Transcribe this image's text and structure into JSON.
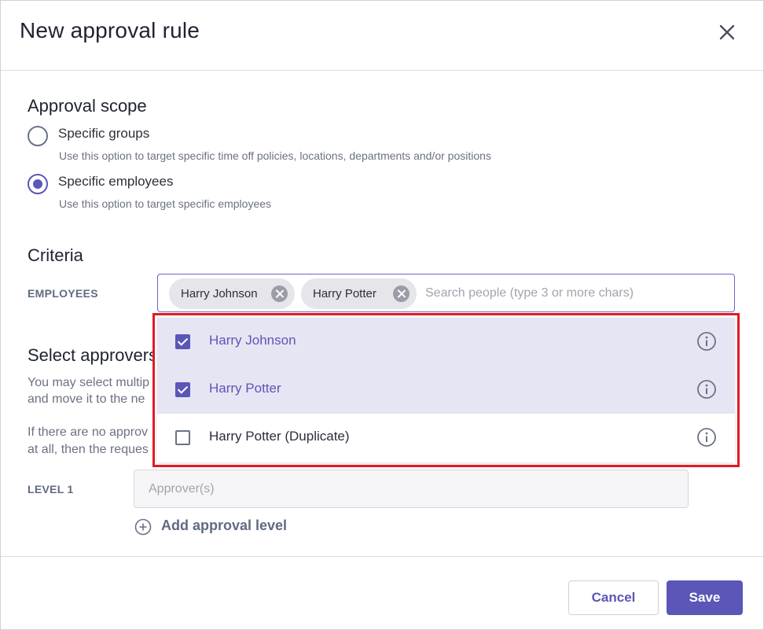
{
  "dialog": {
    "title": "New approval rule"
  },
  "scope": {
    "heading": "Approval scope",
    "options": [
      {
        "label": "Specific groups",
        "help": "Use this option to target specific time off policies, locations, departments and/or positions",
        "checked": false
      },
      {
        "label": "Specific employees",
        "help": "Use this option to target specific employees",
        "checked": true
      }
    ]
  },
  "criteria": {
    "heading": "Criteria",
    "employees_label": "EMPLOYEES",
    "chips": [
      "Harry Johnson",
      "Harry Potter"
    ],
    "search_placeholder": "Search people (type 3 or more chars)",
    "dropdown": [
      {
        "label": "Harry Johnson",
        "checked": true
      },
      {
        "label": "Harry Potter",
        "checked": true
      },
      {
        "label": "Harry Potter (Duplicate)",
        "checked": false
      }
    ]
  },
  "approvers": {
    "heading_partial": "Select approvers",
    "desc_line1": "You may select multip",
    "desc_line2": "and move it to the ne",
    "desc_line3": "If there are no approv",
    "desc_line4": "at all, then the reques",
    "level_label": "LEVEL 1",
    "approver_placeholder": "Approver(s)",
    "add_level_label": "Add approval level"
  },
  "footer": {
    "cancel_label": "Cancel",
    "save_label": "Save"
  },
  "colors": {
    "accent": "#5b56b8",
    "selected_row": "#e6e5f3",
    "highlight": "#e01b24"
  }
}
